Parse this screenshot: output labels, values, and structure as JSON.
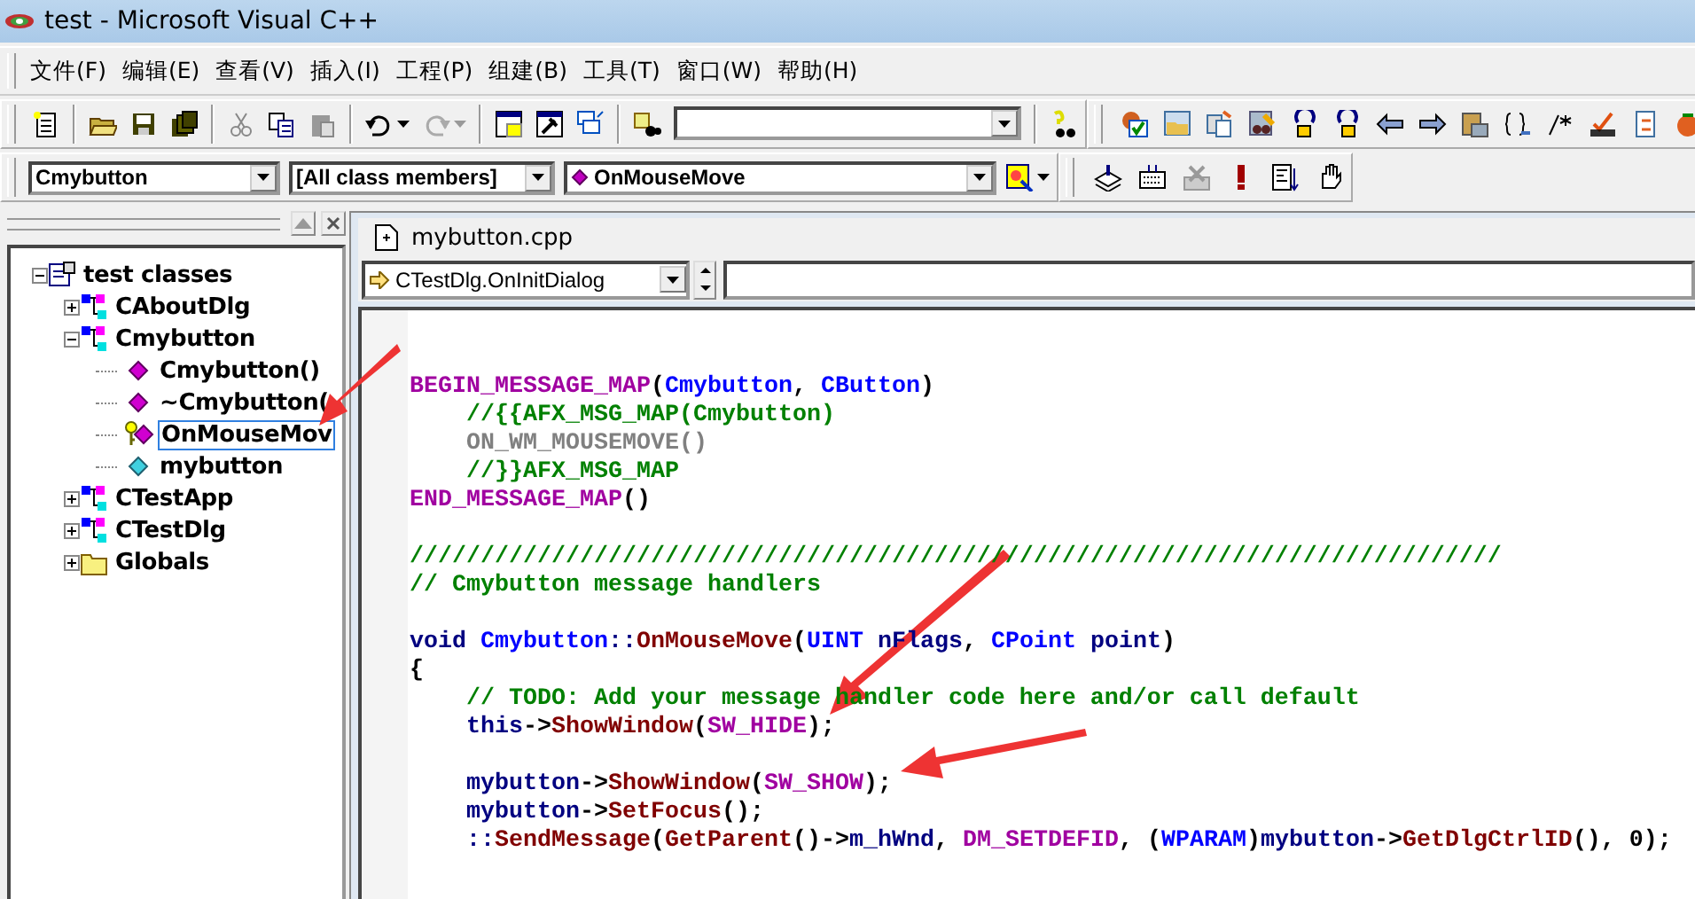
{
  "window": {
    "title": "test - Microsoft Visual C++"
  },
  "menu": [
    {
      "label": "文件(F)"
    },
    {
      "label": "编辑(E)"
    },
    {
      "label": "查看(V)"
    },
    {
      "label": "插入(I)"
    },
    {
      "label": "工程(P)"
    },
    {
      "label": "组建(B)"
    },
    {
      "label": "工具(T)"
    },
    {
      "label": "窗口(W)"
    },
    {
      "label": "帮助(H)"
    }
  ],
  "wizard_bar": {
    "class_combo": "Cmybutton",
    "filter_combo": "[All class members]",
    "member_combo": "OnMouseMove"
  },
  "workspace": {
    "tree": [
      {
        "label": "test classes",
        "kind": "project",
        "expanded": true,
        "selected": false,
        "children": [
          {
            "label": "CAboutDlg",
            "kind": "class",
            "expanded": false,
            "selected": false
          },
          {
            "label": "Cmybutton",
            "kind": "class",
            "expanded": true,
            "selected": false,
            "children": [
              {
                "label": "Cmybutton()",
                "kind": "method",
                "selected": false
              },
              {
                "label": "~Cmybutton(",
                "kind": "method",
                "selected": false
              },
              {
                "label": "OnMouseMov",
                "kind": "handler",
                "selected": true
              },
              {
                "label": "mybutton",
                "kind": "variable",
                "selected": false
              }
            ]
          },
          {
            "label": "CTestApp",
            "kind": "class",
            "expanded": false,
            "selected": false
          },
          {
            "label": "CTestDlg",
            "kind": "class",
            "expanded": false,
            "selected": false
          },
          {
            "label": "Globals",
            "kind": "folder",
            "expanded": false,
            "selected": false
          }
        ]
      }
    ]
  },
  "editor": {
    "title": "mybutton.cpp",
    "nav_combo": "CTestDlg.OnInitDialog",
    "lines": [
      {
        "kind": "blank"
      },
      {
        "kind": "blank"
      },
      {
        "kind": "code",
        "tokens": [
          {
            "kind": "macro",
            "text": "BEGIN_MESSAGE_MAP"
          },
          {
            "kind": "punct",
            "text": "("
          },
          {
            "kind": "class",
            "text": "Cmybutton"
          },
          {
            "kind": "punct",
            "text": ", "
          },
          {
            "kind": "class",
            "text": "CButton"
          },
          {
            "kind": "punct",
            "text": ")"
          }
        ]
      },
      {
        "kind": "code",
        "indented": true,
        "tokens": [
          {
            "kind": "comment",
            "text": "//{{AFX_MSG_MAP(Cmybutton)"
          }
        ]
      },
      {
        "kind": "code",
        "indented": true,
        "tokens": [
          {
            "kind": "disabled",
            "text": "ON_WM_MOUSEMOVE()"
          }
        ]
      },
      {
        "kind": "code",
        "indented": true,
        "tokens": [
          {
            "kind": "comment",
            "text": "//}}AFX_MSG_MAP"
          }
        ]
      },
      {
        "kind": "code",
        "tokens": [
          {
            "kind": "macro",
            "text": "END_MESSAGE_MAP"
          },
          {
            "kind": "punct",
            "text": "()"
          }
        ]
      },
      {
        "kind": "blank"
      },
      {
        "kind": "code",
        "tokens": [
          {
            "kind": "comment",
            "text": "/////////////////////////////////////////////////////////////////////////////"
          }
        ]
      },
      {
        "kind": "code",
        "tokens": [
          {
            "kind": "comment",
            "text": "// Cmybutton message handlers"
          }
        ]
      },
      {
        "kind": "blank"
      },
      {
        "kind": "code",
        "tokens": [
          {
            "kind": "ident",
            "text": "void"
          },
          {
            "kind": "class",
            "text": " Cmybutton"
          },
          {
            "kind": "ident",
            "text": "::"
          },
          {
            "kind": "func",
            "text": "OnMouseMove"
          },
          {
            "kind": "punct",
            "text": "("
          },
          {
            "kind": "class",
            "text": "UINT"
          },
          {
            "kind": "ident",
            "text": " nFlags"
          },
          {
            "kind": "punct",
            "text": ", "
          },
          {
            "kind": "class",
            "text": "CPoint"
          },
          {
            "kind": "ident",
            "text": " point"
          },
          {
            "kind": "punct",
            "text": ")"
          }
        ]
      },
      {
        "kind": "code",
        "tokens": [
          {
            "kind": "punct",
            "text": "{"
          }
        ]
      },
      {
        "kind": "code",
        "indented": true,
        "tokens": [
          {
            "kind": "comment",
            "text": "// TODO: Add your message handler code here and/or call default"
          }
        ]
      },
      {
        "kind": "code",
        "indented": true,
        "tokens": [
          {
            "kind": "ident",
            "text": "this"
          },
          {
            "kind": "punct",
            "text": "->"
          },
          {
            "kind": "func",
            "text": "ShowWindow"
          },
          {
            "kind": "punct",
            "text": "("
          },
          {
            "kind": "macro",
            "text": "SW_HIDE"
          },
          {
            "kind": "punct",
            "text": ");"
          }
        ]
      },
      {
        "kind": "blank"
      },
      {
        "kind": "code",
        "indented": true,
        "tokens": [
          {
            "kind": "ident",
            "text": "mybutton"
          },
          {
            "kind": "punct",
            "text": "->"
          },
          {
            "kind": "func",
            "text": "ShowWindow"
          },
          {
            "kind": "punct",
            "text": "("
          },
          {
            "kind": "macro",
            "text": "SW_SHOW"
          },
          {
            "kind": "punct",
            "text": ");"
          }
        ]
      },
      {
        "kind": "code",
        "indented": true,
        "tokens": [
          {
            "kind": "ident",
            "text": "mybutton"
          },
          {
            "kind": "punct",
            "text": "->"
          },
          {
            "kind": "func",
            "text": "SetFocus"
          },
          {
            "kind": "punct",
            "text": "();"
          }
        ]
      },
      {
        "kind": "code",
        "indented": true,
        "tokens": [
          {
            "kind": "ident",
            "text": "::"
          },
          {
            "kind": "func",
            "text": "SendMessage"
          },
          {
            "kind": "punct",
            "text": "("
          },
          {
            "kind": "func",
            "text": "GetParent"
          },
          {
            "kind": "punct",
            "text": "()->"
          },
          {
            "kind": "ident",
            "text": "m_hWnd"
          },
          {
            "kind": "punct",
            "text": ", "
          },
          {
            "kind": "macro",
            "text": "DM_SETDEFID"
          },
          {
            "kind": "punct",
            "text": ", ("
          },
          {
            "kind": "class",
            "text": "WPARAM"
          },
          {
            "kind": "punct",
            "text": ")"
          },
          {
            "kind": "ident",
            "text": "mybutton"
          },
          {
            "kind": "punct",
            "text": "->"
          },
          {
            "kind": "func",
            "text": "GetDlgCtrlID"
          },
          {
            "kind": "punct",
            "text": "(), 0);"
          }
        ]
      }
    ]
  }
}
